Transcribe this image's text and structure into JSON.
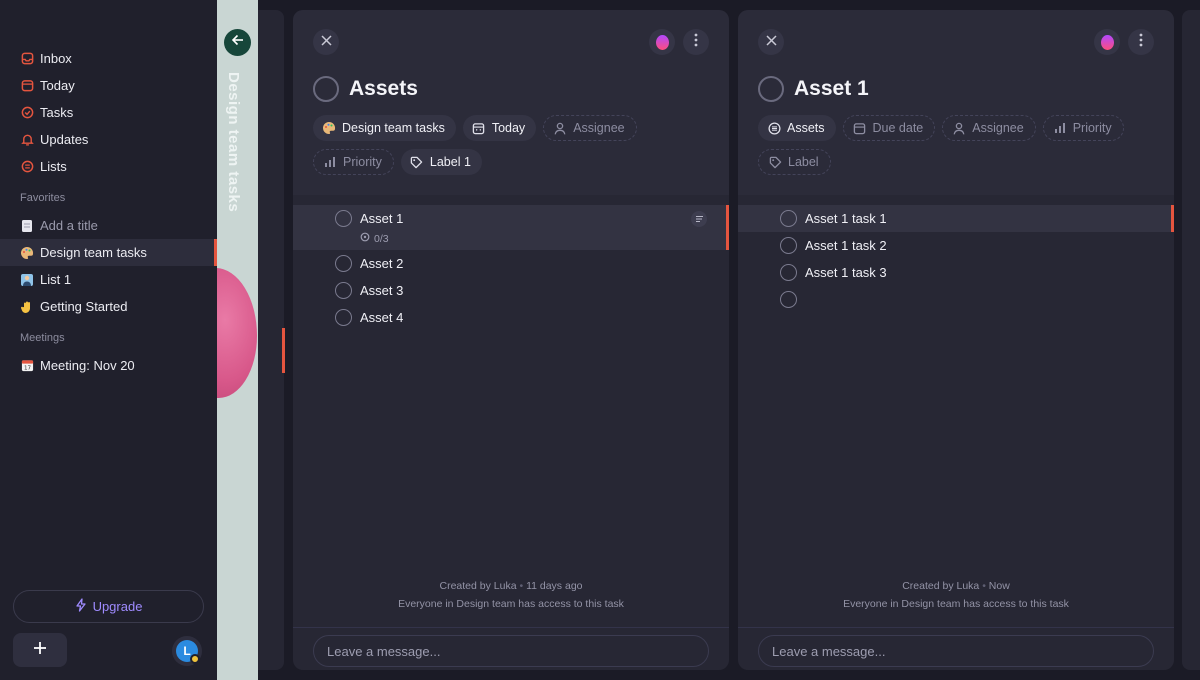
{
  "sidebar": {
    "nav": [
      {
        "label": "Inbox",
        "icon": "inbox-icon"
      },
      {
        "label": "Today",
        "icon": "calendar-icon"
      },
      {
        "label": "Tasks",
        "icon": "check-circle-icon"
      },
      {
        "label": "Updates",
        "icon": "bell-icon"
      },
      {
        "label": "Lists",
        "icon": "list-icon"
      }
    ],
    "favorites_label": "Favorites",
    "favorites": [
      {
        "label": "Add a title",
        "icon": "note-icon"
      },
      {
        "label": "Design team tasks",
        "icon": "palette-emoji"
      },
      {
        "label": "List 1",
        "icon": "person-emoji"
      },
      {
        "label": "Getting Started",
        "icon": "wave-emoji"
      }
    ],
    "meetings_label": "Meetings",
    "meetings": [
      {
        "label": "Meeting: Nov 20",
        "icon": "calendar-emoji"
      }
    ],
    "upgrade_label": "Upgrade",
    "avatar_initial": "L"
  },
  "collapsed_panel": {
    "title": "Design team tasks"
  },
  "panel1": {
    "title": "Assets",
    "chips": {
      "project": "Design team tasks",
      "date": "Today",
      "assignee": "Assignee",
      "priority": "Priority",
      "label": "Label 1"
    },
    "subtasks": [
      {
        "label": "Asset 1",
        "meta": "0/3"
      },
      {
        "label": "Asset 2"
      },
      {
        "label": "Asset 3"
      },
      {
        "label": "Asset 4"
      }
    ],
    "created": "Created by Luka",
    "created_when": "11 days ago",
    "access": "Everyone in Design team has access to this task",
    "message_placeholder": "Leave a message..."
  },
  "panel2": {
    "title": "Asset 1",
    "chips": {
      "parent": "Assets",
      "due": "Due date",
      "assignee": "Assignee",
      "priority": "Priority",
      "label": "Label"
    },
    "subtasks": [
      {
        "label": "Asset 1 task 1"
      },
      {
        "label": "Asset 1 task 2"
      },
      {
        "label": "Asset 1 task 3"
      },
      {
        "label": ""
      }
    ],
    "created": "Created by Luka",
    "created_when": "Now",
    "access": "Everyone in Design team has access to this task",
    "message_placeholder": "Leave a message..."
  },
  "colors": {
    "accent": "#e5553f",
    "upgrade": "#9f8bff",
    "background": "#1b1b26"
  }
}
